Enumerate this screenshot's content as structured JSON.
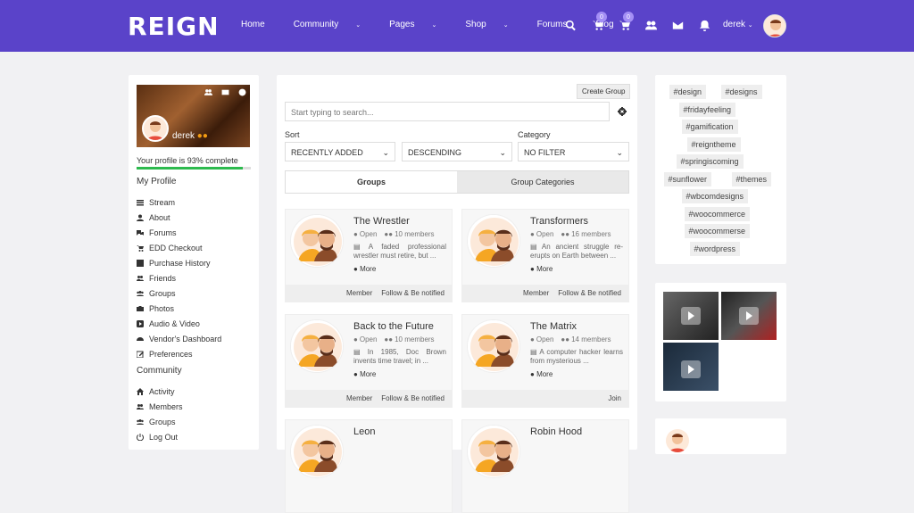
{
  "header": {
    "logo": "REIGN",
    "nav": [
      {
        "label": "Home",
        "dropdown": false
      },
      {
        "label": "Community",
        "dropdown": true
      },
      {
        "label": "Pages",
        "dropdown": true
      },
      {
        "label": "Shop",
        "dropdown": true
      },
      {
        "label": "Forums",
        "dropdown": false
      },
      {
        "label": "Blog",
        "dropdown": false
      }
    ],
    "cart_badge_1": "0",
    "cart_badge_2": "0",
    "username": "derek"
  },
  "profile": {
    "name": "derek",
    "complete_text": "Your profile is 93% complete",
    "complete_pct": 93,
    "my_profile_title": "My Profile",
    "menu": [
      "Stream",
      "About",
      "Forums",
      "EDD Checkout",
      "Purchase History",
      "Friends",
      "Groups",
      "Photos",
      "Audio & Video",
      "Vendor's Dashboard",
      "Preferences"
    ],
    "community_title": "Community",
    "community_menu": [
      "Activity",
      "Members",
      "Groups",
      "Log Out"
    ]
  },
  "groups": {
    "create_label": "Create Group",
    "search_placeholder": "Start typing to search...",
    "sort_label": "Sort",
    "sort_value": "RECENTLY ADDED",
    "order_value": "DESCENDING",
    "category_label": "Category",
    "category_value": "NO FILTER",
    "tab_groups": "Groups",
    "tab_categories": "Group Categories",
    "cards": [
      {
        "name": "The Wrestler",
        "status": "Open",
        "members": "10 members",
        "desc": "A faded professional wrestler must retire, but ...",
        "more": "More",
        "actions": [
          "Member",
          "Follow & Be notified"
        ]
      },
      {
        "name": "Transformers",
        "status": "Open",
        "members": "16 members",
        "desc": "An ancient struggle re-erupts on Earth between ...",
        "more": "More",
        "actions": [
          "Member",
          "Follow & Be notified"
        ]
      },
      {
        "name": "Back to the Future",
        "status": "Open",
        "members": "10 members",
        "desc": "In 1985, Doc Brown invents time travel; in ...",
        "more": "More",
        "actions": [
          "Member",
          "Follow & Be notified"
        ]
      },
      {
        "name": "The Matrix",
        "status": "Open",
        "members": "14 members",
        "desc": "A computer hacker learns from mysterious ...",
        "more": "More",
        "actions": [
          "Join"
        ]
      },
      {
        "name": "Leon",
        "status": "",
        "members": "",
        "desc": "",
        "more": "",
        "actions": []
      },
      {
        "name": "Robin Hood",
        "status": "",
        "members": "",
        "desc": "",
        "more": "",
        "actions": []
      }
    ]
  },
  "tags": [
    "#design",
    "#designs",
    "#fridayfeeling",
    "#gamification",
    "#reigntheme",
    "#springiscoming",
    "#sunflower",
    "#themes",
    "#wbcomdesigns",
    "#woocommerce",
    "#woocommerse",
    "#wordpress"
  ]
}
